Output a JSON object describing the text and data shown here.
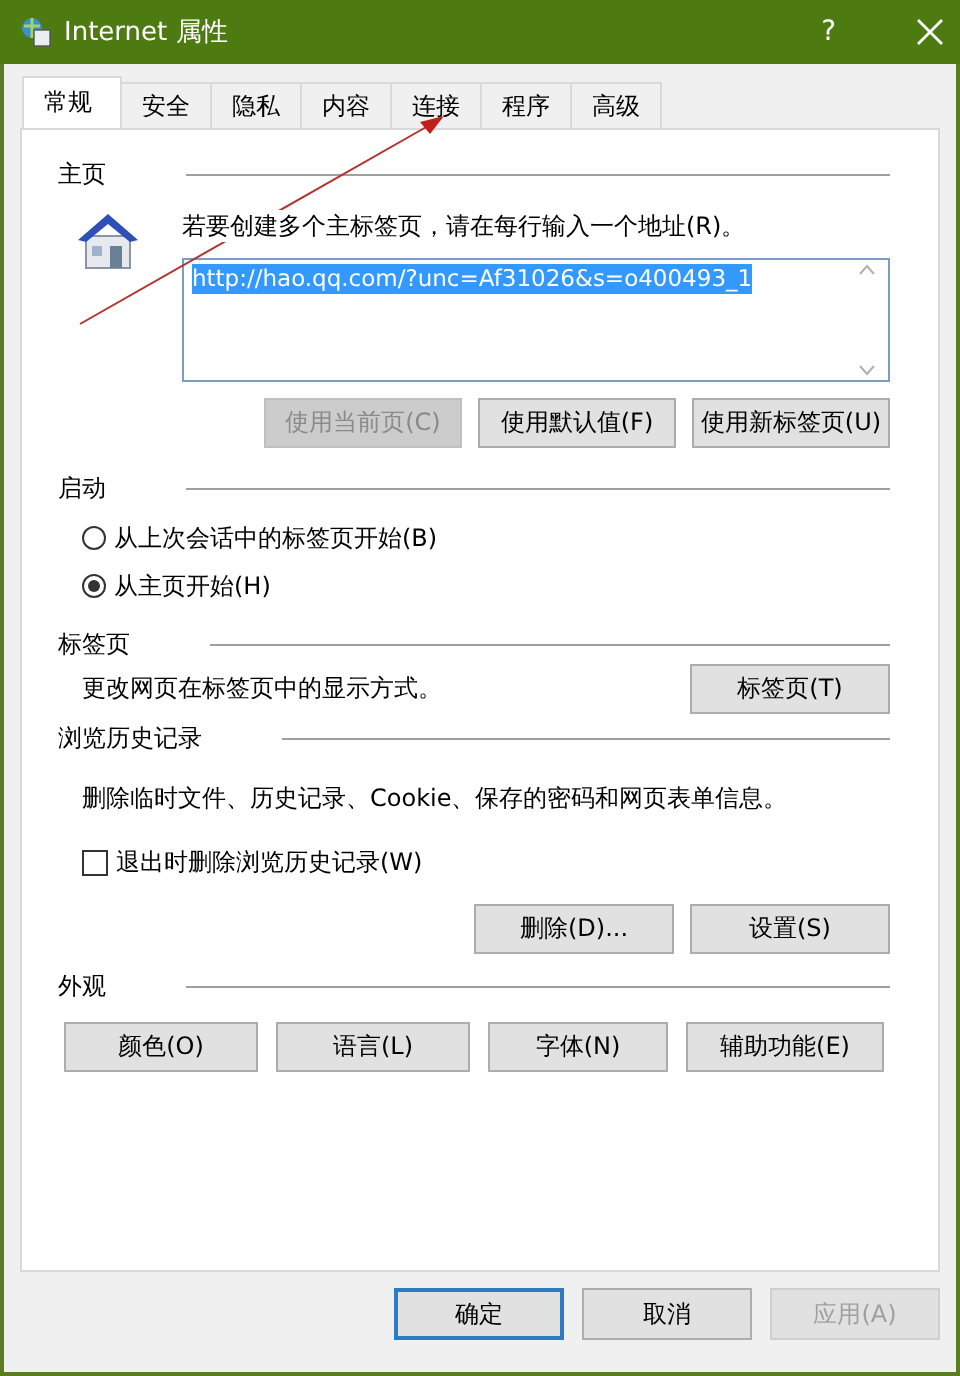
{
  "window": {
    "title": "Internet 属性",
    "help": "?"
  },
  "tabs": [
    {
      "label": "常规",
      "selected": true
    },
    {
      "label": "安全",
      "selected": false
    },
    {
      "label": "隐私",
      "selected": false
    },
    {
      "label": "内容",
      "selected": false
    },
    {
      "label": "连接",
      "selected": false
    },
    {
      "label": "程序",
      "selected": false
    },
    {
      "label": "高级",
      "selected": false
    }
  ],
  "home_page": {
    "heading": "主页",
    "description": "若要创建多个主标签页，请在每行输入一个地址(R)。",
    "addresses": "http://hao.qq.com/?unc=Af31026&s=o400493_1",
    "buttons": [
      {
        "label": "使用当前页(C)",
        "disabled": true
      },
      {
        "label": "使用默认值(F)",
        "disabled": false
      },
      {
        "label": "使用新标签页(U)",
        "disabled": false
      }
    ]
  },
  "startup": {
    "heading": "启动",
    "options": [
      {
        "label": "从上次会话中的标签页开始(B)",
        "selected": false
      },
      {
        "label": "从主页开始(H)",
        "selected": true
      }
    ]
  },
  "tabs_group": {
    "heading": "标签页",
    "description": "更改网页在标签页中的显示方式。",
    "button": {
      "label": "标签页(T)",
      "disabled": false
    }
  },
  "history": {
    "heading": "浏览历史记录",
    "description": "删除临时文件、历史记录、Cookie、保存的密码和网页表单信息。",
    "checkbox": {
      "label": "退出时删除浏览历史记录(W)",
      "checked": false
    },
    "buttons": [
      {
        "label": "删除(D)...",
        "disabled": false
      },
      {
        "label": "设置(S)",
        "disabled": false
      }
    ]
  },
  "appearance": {
    "heading": "外观",
    "buttons": [
      {
        "label": "颜色(O)",
        "disabled": false
      },
      {
        "label": "语言(L)",
        "disabled": false
      },
      {
        "label": "字体(N)",
        "disabled": false
      },
      {
        "label": "辅助功能(E)",
        "disabled": false
      }
    ]
  },
  "footer_buttons": [
    {
      "label": "确定",
      "kind": "default",
      "disabled": false
    },
    {
      "label": "取消",
      "kind": "normal",
      "disabled": false
    },
    {
      "label": "应用(A)",
      "kind": "normal",
      "disabled": true
    }
  ]
}
